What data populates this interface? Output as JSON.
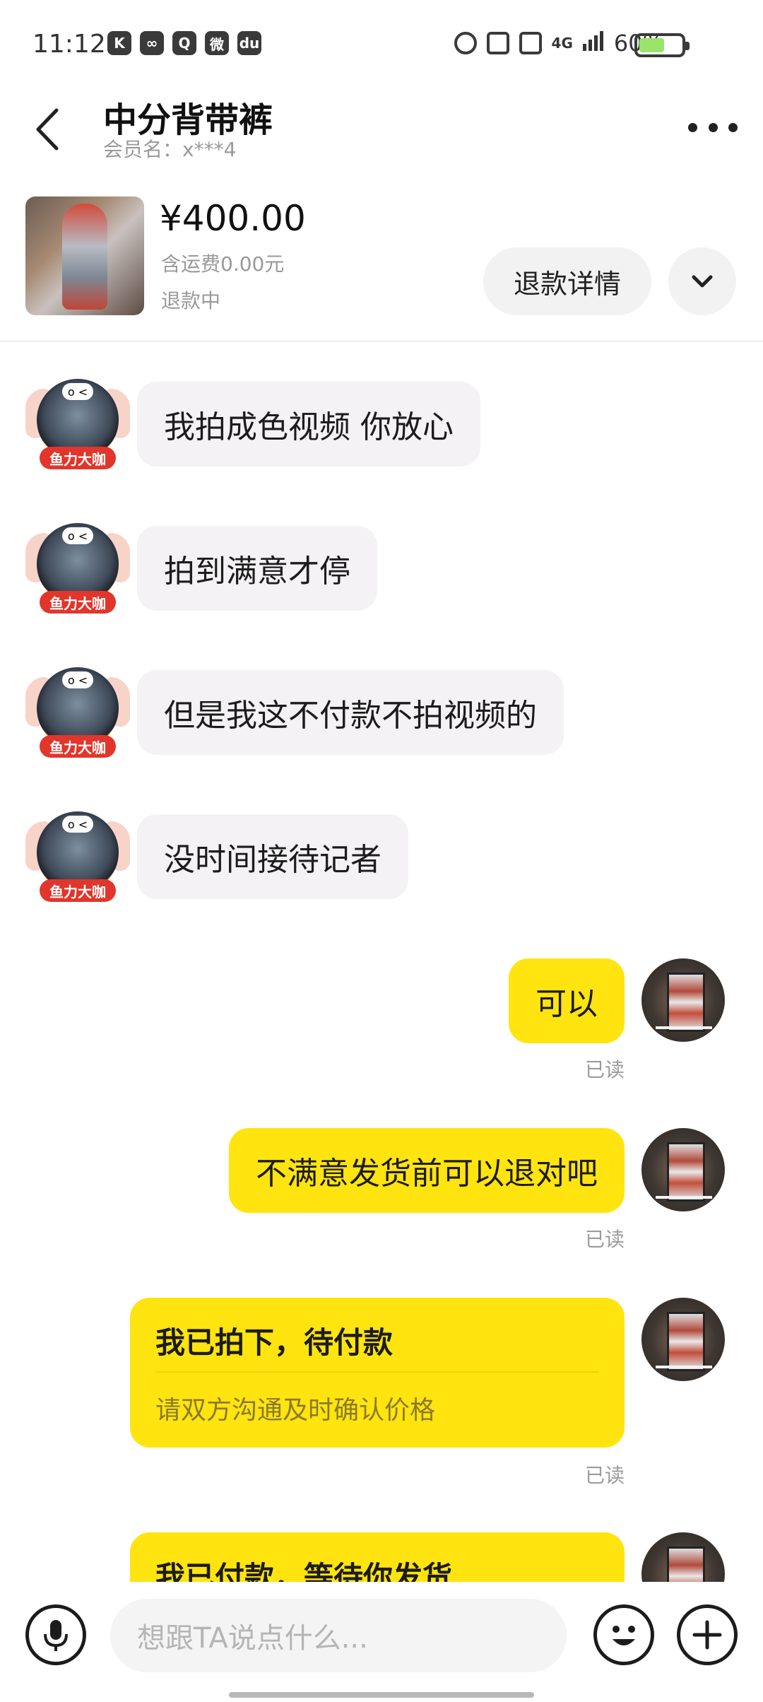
{
  "status_bar": {
    "time": "11:12",
    "app_icons": [
      "K",
      "∞",
      "Q",
      "微",
      "du"
    ],
    "network": "4G",
    "battery": "60%",
    "battery_level": 0.6
  },
  "header": {
    "title": "中分背带裤",
    "member": "会员名：x***4"
  },
  "product": {
    "price": "¥400.00",
    "shipping": "含运费0.00元",
    "status": "退款中",
    "refund_button": "退款详情"
  },
  "messages": [
    {
      "side": "in",
      "text": "我拍成色视频 你放心"
    },
    {
      "side": "in",
      "text": "拍到满意才停"
    },
    {
      "side": "in",
      "text": "但是我这不付款不拍视频的"
    },
    {
      "side": "in",
      "text": "没时间接待记者"
    },
    {
      "side": "out",
      "text": "可以",
      "read": "已读"
    },
    {
      "side": "out",
      "text": "不满意发货前可以退对吧",
      "read": "已读"
    },
    {
      "side": "out",
      "type": "card",
      "title": "我已拍下，待付款",
      "subtitle": "请双方沟通及时确认价格",
      "read": "已读"
    },
    {
      "side": "out",
      "type": "card",
      "title": "我已付款，等待你发货"
    }
  ],
  "seller_badge": "鱼力大咖",
  "seller_face": "o <",
  "input": {
    "placeholder": "想跟TA说点什么..."
  },
  "colors": {
    "accent": "#ffe40f",
    "incoming_bubble": "#f4f2f4",
    "muted_text": "#999999"
  }
}
